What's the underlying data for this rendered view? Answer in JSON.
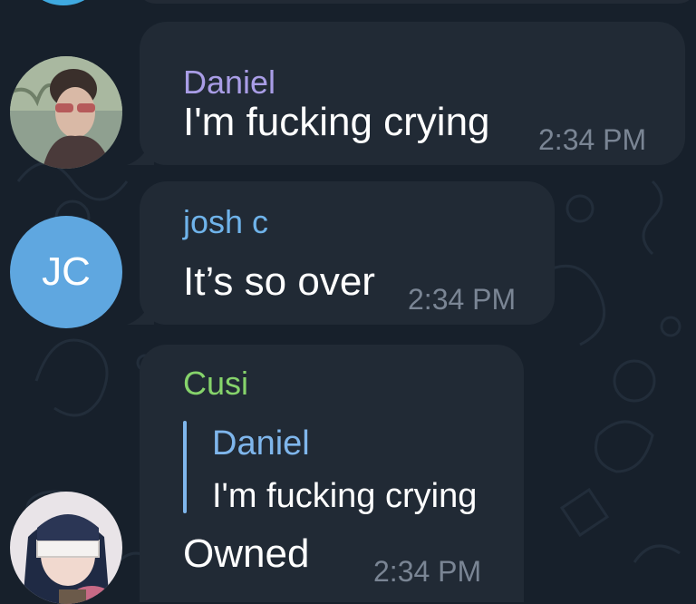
{
  "messages": [
    {
      "sender": "Daniel",
      "sender_color": "#a99de6",
      "text": "I'm fucking crying",
      "time": "2:34 PM",
      "avatar": {
        "type": "photo",
        "icon": "user-photo-avatar"
      }
    },
    {
      "sender": "josh c",
      "sender_color": "#6fb3ea",
      "text": "It’s so over",
      "time": "2:34 PM",
      "avatar": {
        "type": "initials",
        "initials": "JC",
        "color": "#5fa7e0"
      }
    },
    {
      "sender": "Cusi",
      "sender_color": "#86d36b",
      "reply": {
        "sender": "Daniel",
        "text": "I'm fucking crying"
      },
      "text": "Owned",
      "time": "2:34 PM",
      "avatar": {
        "type": "photo",
        "icon": "anime-avatar"
      }
    }
  ],
  "colors": {
    "background": "#17202b",
    "bubble": "#212a35",
    "timestamp": "#7a8594",
    "reply_accent": "#7fb6ec"
  }
}
